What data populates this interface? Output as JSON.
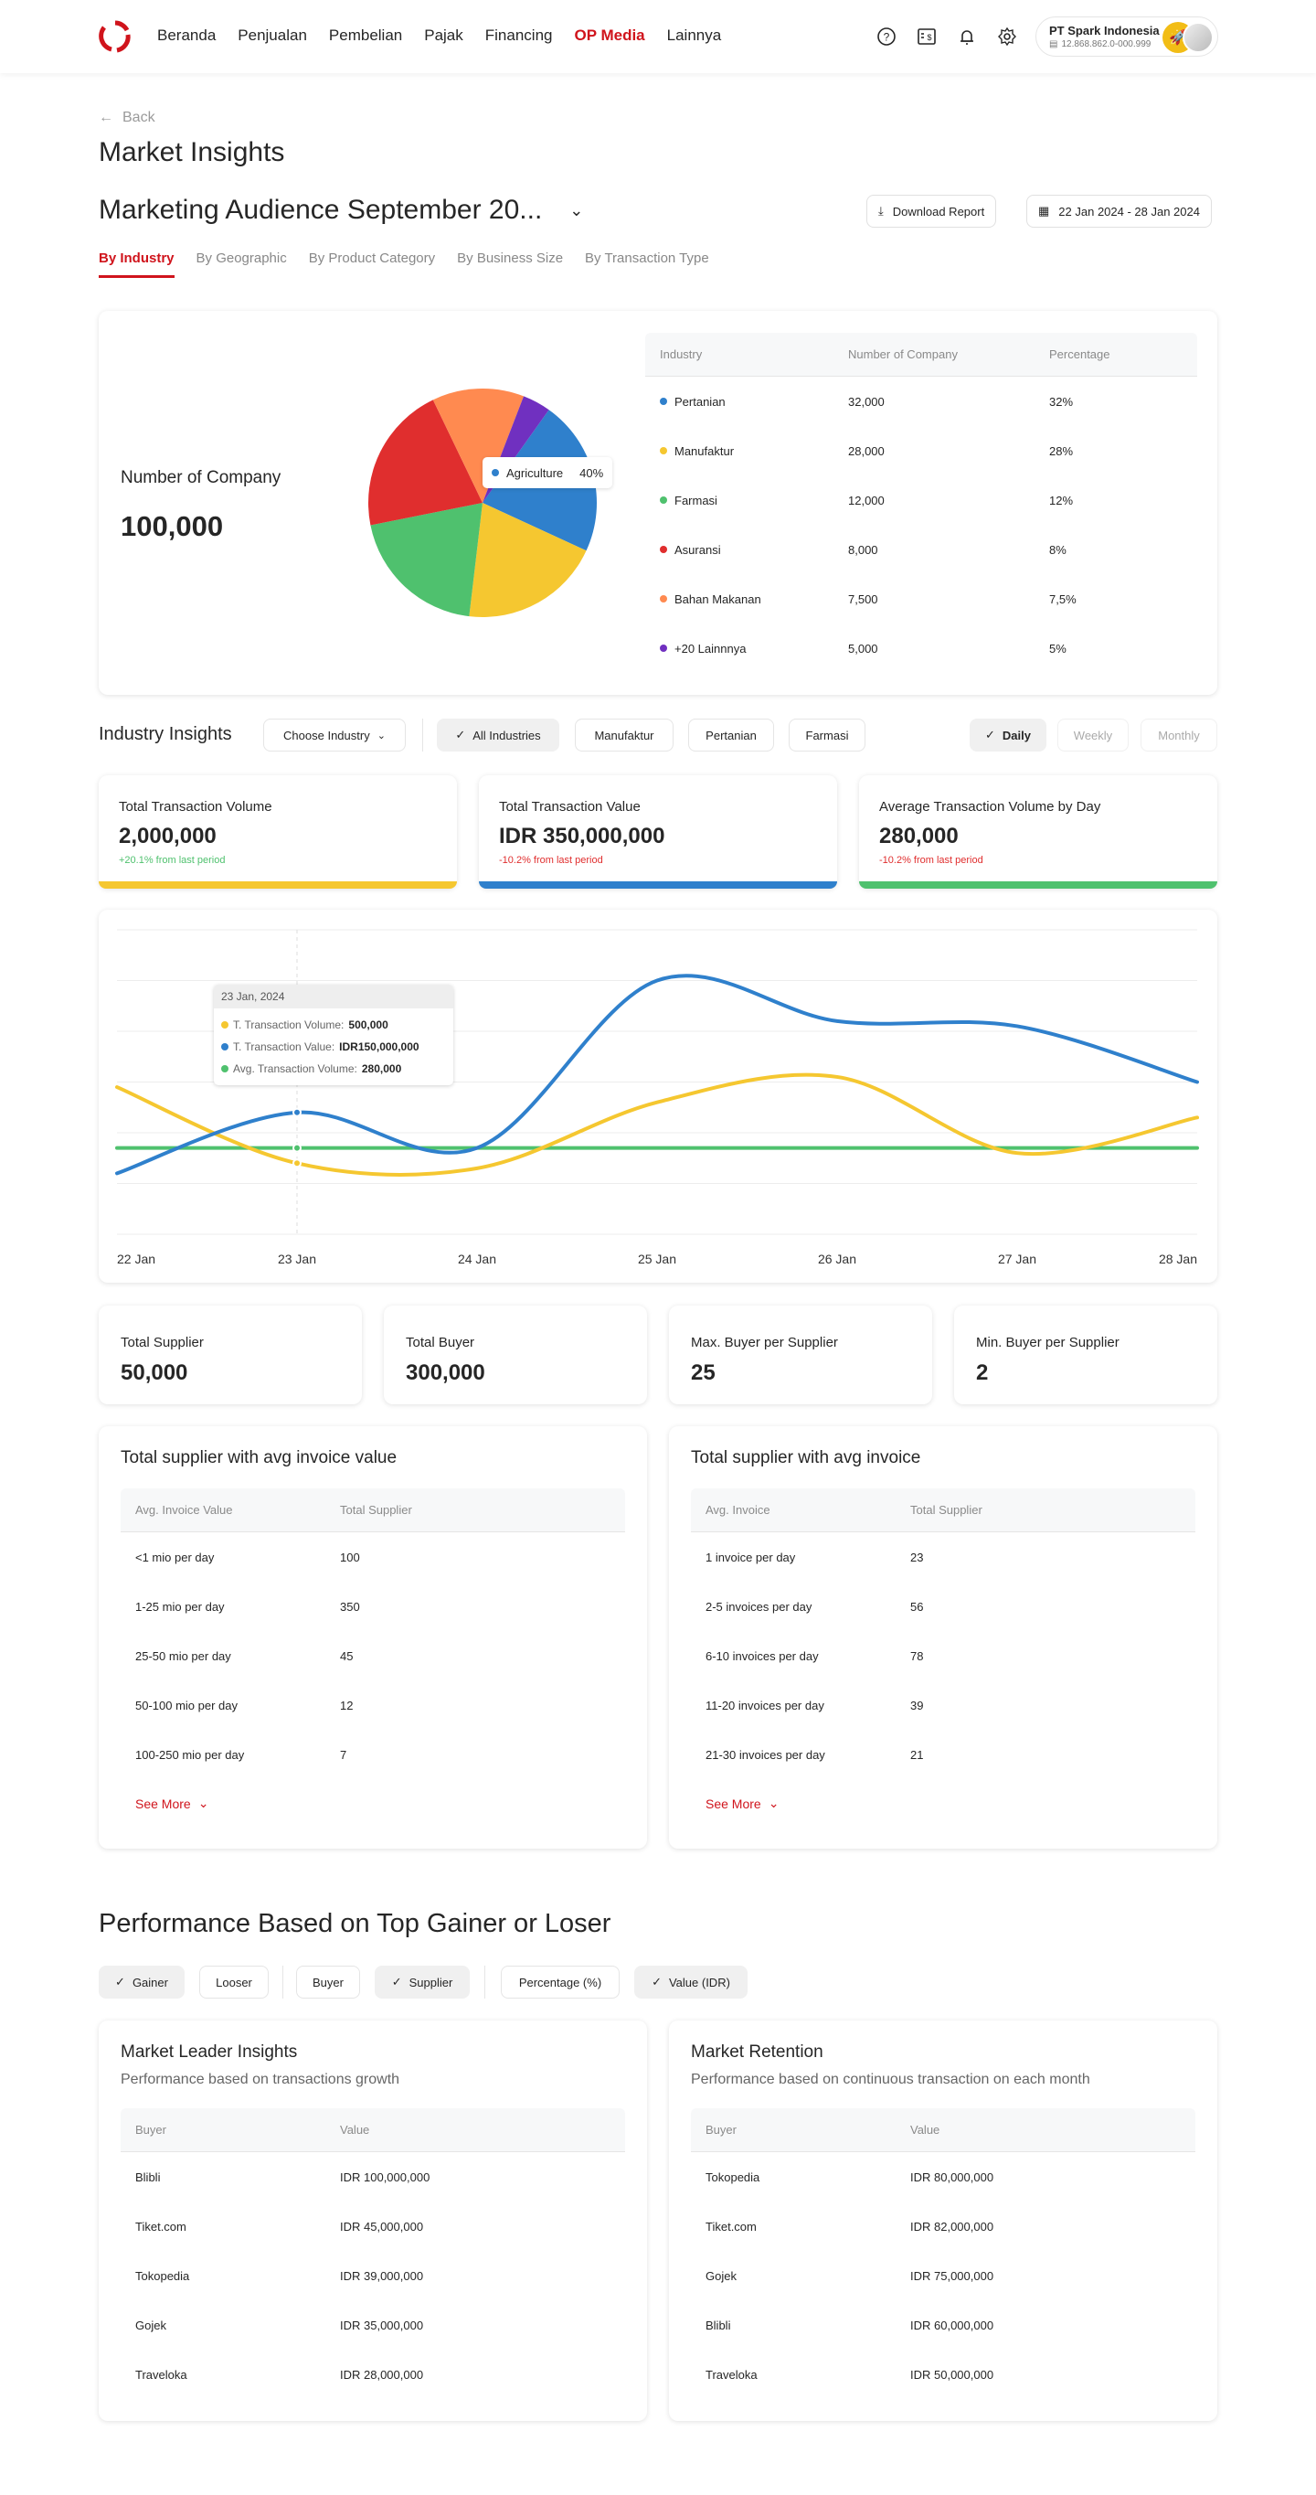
{
  "nav": {
    "items": [
      "Beranda",
      "Penjualan",
      "Pembelian",
      "Pajak",
      "Financing",
      "OP Media",
      "Lainnya"
    ],
    "active_index": 5,
    "icons": [
      "help-icon",
      "invoice-icon",
      "bell-icon",
      "gear-icon"
    ],
    "profile": {
      "company": "PT Spark Indonesia",
      "npwp": "12.868.862.0-000.999"
    }
  },
  "header": {
    "back_label": "Back",
    "title": "Market Insights",
    "audience": "Marketing Audience September 20...",
    "download_label": "Download Report",
    "date_range": "22 Jan 2024 - 28 Jan 2024",
    "tabs": [
      "By Industry",
      "By Geographic",
      "By Product Category",
      "By Business Size",
      "By Transaction Type"
    ],
    "active_tab": 0
  },
  "company_overview": {
    "label": "Number of Company",
    "value": "100,000",
    "pie_tooltip": {
      "label": "Agriculture",
      "value": "40%"
    },
    "table": {
      "headers": [
        "Industry",
        "Number of Company",
        "Percentage"
      ],
      "rows": [
        {
          "industry": "Pertanian",
          "count": "32,000",
          "pct": "32%",
          "color": "#2f80cc"
        },
        {
          "industry": "Manufaktur",
          "count": "28,000",
          "pct": "28%",
          "color": "#f5c730"
        },
        {
          "industry": "Farmasi",
          "count": "12,000",
          "pct": "12%",
          "color": "#4fc16e"
        },
        {
          "industry": "Asuransi",
          "count": "8,000",
          "pct": "8%",
          "color": "#e02e2e"
        },
        {
          "industry": "Bahan Makanan",
          "count": "7,500",
          "pct": "7,5%",
          "color": "#ff8a50"
        },
        {
          "industry": "+20 Lainnnya",
          "count": "5,000",
          "pct": "5%",
          "color": "#7030c0"
        }
      ]
    }
  },
  "industry_insights": {
    "title": "Industry Insights",
    "choose_label": "Choose Industry",
    "filters": [
      {
        "label": "All Industries",
        "selected": true
      },
      {
        "label": "Manufaktur",
        "selected": false
      },
      {
        "label": "Pertanian",
        "selected": false
      },
      {
        "label": "Farmasi",
        "selected": false
      }
    ],
    "periods": [
      {
        "label": "Daily",
        "selected": true
      },
      {
        "label": "Weekly",
        "selected": false
      },
      {
        "label": "Monthly",
        "selected": false
      }
    ],
    "kpis": [
      {
        "label": "Total Transaction Volume",
        "value": "2,000,000",
        "delta": "+20.1% from last period",
        "delta_color": "#4fc16e",
        "bar_color": "#f5c730"
      },
      {
        "label": "Total Transaction Value",
        "value": "IDR 350,000,000",
        "delta": "-10.2% from last period",
        "delta_color": "#e02e2e",
        "bar_color": "#2f80cc"
      },
      {
        "label": "Average Transaction Volume by Day",
        "value": "280,000",
        "delta": "-10.2% from last period",
        "delta_color": "#e02e2e",
        "bar_color": "#4fc16e"
      }
    ]
  },
  "chart_data": [
    {
      "type": "pie",
      "title": "Number of Company",
      "categories": [
        "Agriculture",
        "Manufaktur",
        "Farmasi",
        "Asuransi",
        "Bahan Makanan",
        "Lainnya"
      ],
      "values": [
        22,
        20,
        20,
        21,
        13,
        4
      ],
      "colors": [
        "#2f80cc",
        "#f5c730",
        "#4fc16e",
        "#e02e2e",
        "#ff8a50",
        "#7030c0"
      ],
      "tooltip": "Agriculture 40%"
    },
    {
      "type": "line",
      "title": "",
      "x": [
        "22 Jan",
        "23 Jan",
        "24 Jan",
        "25 Jan",
        "26 Jan",
        "27 Jan",
        "28 Jan"
      ],
      "ylim": [
        0,
        6
      ],
      "grid": true,
      "series": [
        {
          "name": "T. Transaction Volume",
          "color": "#f5c730",
          "values": [
            2.9,
            1.4,
            1.3,
            2.6,
            3.1,
            1.6,
            2.3
          ]
        },
        {
          "name": "T. Transaction Value",
          "color": "#2f80cc",
          "values": [
            1.2,
            2.4,
            1.7,
            5.0,
            4.2,
            4.1,
            3.0
          ]
        },
        {
          "name": "Avg. Transaction Volume",
          "color": "#4fc16e",
          "values": [
            1.7,
            1.7,
            1.7,
            1.7,
            1.7,
            1.7,
            1.7
          ]
        }
      ],
      "tooltip": {
        "date": "23 Jan, 2024",
        "rows": [
          {
            "label": "T. Transaction Volume:",
            "value": "500,000",
            "color": "#f5c730"
          },
          {
            "label": "T. Transaction Value:",
            "value": "IDR150,000,000",
            "color": "#2f80cc"
          },
          {
            "label": "Avg. Transaction Volume:",
            "value": "280,000",
            "color": "#4fc16e"
          }
        ]
      }
    }
  ],
  "summary": [
    {
      "label": "Total Supplier",
      "value": "50,000"
    },
    {
      "label": "Total Buyer",
      "value": "300,000"
    },
    {
      "label": "Max. Buyer per Supplier",
      "value": "25"
    },
    {
      "label": "Min. Buyer per Supplier",
      "value": "2"
    }
  ],
  "supplier_tables": [
    {
      "title": "Total supplier with avg invoice value",
      "headers": [
        "Avg. Invoice Value",
        "Total Supplier"
      ],
      "rows": [
        [
          "<1 mio per day",
          "100"
        ],
        [
          "1-25 mio per day",
          "350"
        ],
        [
          "25-50 mio per day",
          "45"
        ],
        [
          "50-100 mio per day",
          "12"
        ],
        [
          "100-250 mio per day",
          "7"
        ]
      ],
      "see_more": "See More"
    },
    {
      "title": "Total supplier with avg invoice",
      "headers": [
        "Avg. Invoice",
        "Total Supplier"
      ],
      "rows": [
        [
          "1 invoice per day",
          "23"
        ],
        [
          "2-5  invoices per day",
          "56"
        ],
        [
          "6-10  invoices per day",
          "78"
        ],
        [
          "11-20  invoices per day",
          "39"
        ],
        [
          "21-30  invoices per day",
          "21"
        ]
      ],
      "see_more": "See More"
    }
  ],
  "performance": {
    "title": "Performance Based on Top Gainer or Loser",
    "chips": [
      {
        "label": "Gainer",
        "selected": true
      },
      {
        "label": "Looser",
        "selected": false
      },
      {
        "label": "Buyer",
        "selected": false
      },
      {
        "label": "Supplier",
        "selected": true
      },
      {
        "label": "Percentage (%)",
        "selected": false
      },
      {
        "label": "Value (IDR)",
        "selected": true
      }
    ],
    "tables": [
      {
        "title": "Market Leader Insights",
        "subtitle": "Performance based on transactions growth",
        "headers": [
          "Buyer",
          "Value"
        ],
        "rows": [
          [
            "Blibli",
            "IDR 100,000,000"
          ],
          [
            "Tiket.com",
            "IDR 45,000,000"
          ],
          [
            "Tokopedia",
            "IDR 39,000,000"
          ],
          [
            "Gojek",
            "IDR 35,000,000"
          ],
          [
            "Traveloka",
            "IDR 28,000,000"
          ]
        ]
      },
      {
        "title": "Market Retention",
        "subtitle": "Performance based on continuous transaction on each month",
        "headers": [
          "Buyer",
          "Value"
        ],
        "rows": [
          [
            "Tokopedia",
            "IDR 80,000,000"
          ],
          [
            "Tiket.com",
            "IDR 82,000,000"
          ],
          [
            "Gojek",
            "IDR 75,000,000"
          ],
          [
            "Blibli",
            "IDR 60,000,000"
          ],
          [
            "Traveloka",
            "IDR 50,000,000"
          ]
        ]
      }
    ]
  }
}
